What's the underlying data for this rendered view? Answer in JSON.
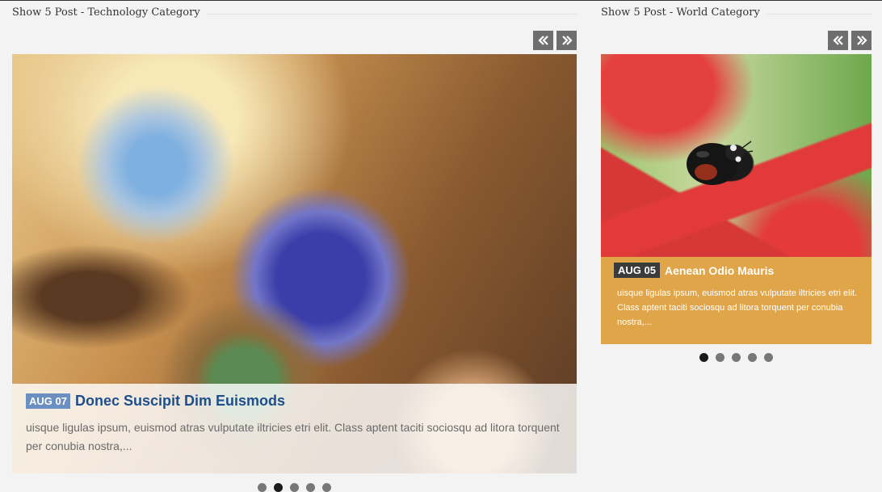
{
  "tech_widget": {
    "title": "Show 5 Post - Technology Category",
    "post": {
      "date": "AUG 07",
      "title": "Donec Suscipit Dim Euismods",
      "excerpt": "uisque ligulas ipsum, euismod atras vulputate iltricies etri elit. Class aptent taciti sociosqu ad litora torquent per conubia nostra,..."
    },
    "pager": {
      "count": 5,
      "active_index": 1
    }
  },
  "world_widget": {
    "title": "Show 5 Post - World Category",
    "post": {
      "date": "AUG 05",
      "title": "Aenean Odio Mauris",
      "excerpt": "uisque ligulas ipsum, euismod atras vulputate iltricies etri elit. Class aptent taciti sociosqu ad litora torquent per conubia nostra,..."
    },
    "pager": {
      "count": 5,
      "active_index": 0
    }
  },
  "icons": {
    "prev": "double-chevron-left-icon",
    "next": "double-chevron-right-icon"
  },
  "colors": {
    "tech_date_badge": "#6b8fc0",
    "tech_title": "#1f4e8c",
    "world_caption_bg": "#e0a548",
    "world_date_badge": "#3b3b3b",
    "nav_button": "#6e6e6e"
  }
}
